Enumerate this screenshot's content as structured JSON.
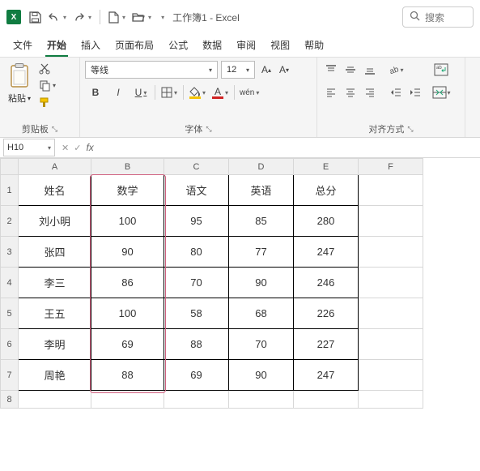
{
  "titlebar": {
    "app_letter": "X",
    "doc_title": "工作簿1 - Excel",
    "search_placeholder": "搜索"
  },
  "tabs": {
    "items": [
      {
        "label": "文件",
        "active": false
      },
      {
        "label": "开始",
        "active": true
      },
      {
        "label": "插入",
        "active": false
      },
      {
        "label": "页面布局",
        "active": false
      },
      {
        "label": "公式",
        "active": false
      },
      {
        "label": "数据",
        "active": false
      },
      {
        "label": "审阅",
        "active": false
      },
      {
        "label": "视图",
        "active": false
      },
      {
        "label": "帮助",
        "active": false
      }
    ]
  },
  "ribbon": {
    "clipboard": {
      "paste": "粘贴",
      "group": "剪贴板"
    },
    "font": {
      "name": "等线",
      "size": "12",
      "group": "字体",
      "bold": "B",
      "italic": "I",
      "underline": "U",
      "ruby": "wén"
    },
    "align": {
      "group": "对齐方式"
    }
  },
  "formula_bar": {
    "cellref": "H10",
    "fx": "fx",
    "value": ""
  },
  "sheet": {
    "columns": [
      "A",
      "B",
      "C",
      "D",
      "E",
      "F"
    ],
    "row_numbers": [
      "1",
      "2",
      "3",
      "4",
      "5",
      "6",
      "7",
      "8"
    ],
    "headers": [
      "姓名",
      "数学",
      "语文",
      "英语",
      "总分"
    ],
    "rows": [
      {
        "name": "刘小明",
        "math": "100",
        "chinese": "95",
        "english": "85",
        "total": "280"
      },
      {
        "name": "张四",
        "math": "90",
        "chinese": "80",
        "english": "77",
        "total": "247"
      },
      {
        "name": "李三",
        "math": "86",
        "chinese": "70",
        "english": "90",
        "total": "246"
      },
      {
        "name": "王五",
        "math": "100",
        "chinese": "58",
        "english": "68",
        "total": "226"
      },
      {
        "name": "李明",
        "math": "69",
        "chinese": "88",
        "english": "70",
        "total": "227"
      },
      {
        "name": "周艳",
        "math": "88",
        "chinese": "69",
        "english": "90",
        "total": "247"
      }
    ]
  }
}
